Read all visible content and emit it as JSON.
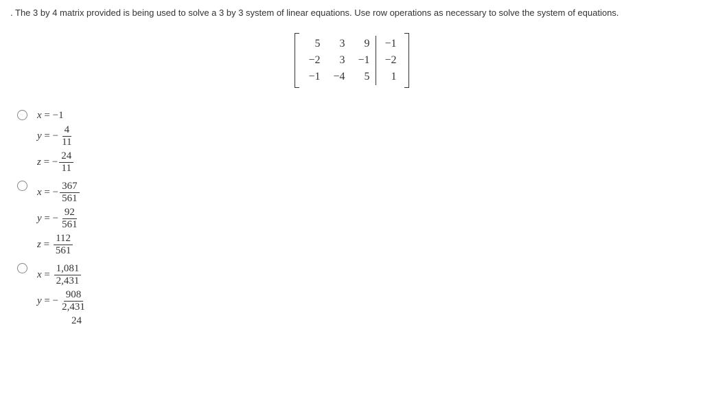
{
  "lead_char": ".",
  "prompt": "The 3 by 4 matrix provided is being used to solve a 3 by 3 system of linear equations. Use row operations as necessary to solve the system of equations.",
  "matrix": {
    "rows": [
      {
        "a": "5",
        "b": "3",
        "c": "9",
        "d": "−1"
      },
      {
        "a": "−2",
        "b": "3",
        "c": "−1",
        "d": "−2"
      },
      {
        "a": "−1",
        "b": "−4",
        "c": "5",
        "d": "1"
      }
    ]
  },
  "options": [
    {
      "eqs": [
        {
          "var": "x",
          "expr_plain": "−1"
        },
        {
          "var": "y",
          "neg": "−",
          "num": "4",
          "den": "11"
        },
        {
          "var": "z",
          "neg": "−",
          "num": "24",
          "den": "11"
        }
      ]
    },
    {
      "eqs": [
        {
          "var": "x",
          "neg": "−",
          "num": "367",
          "den": "561"
        },
        {
          "var": "y",
          "neg": "−",
          "num": "92",
          "den": "561"
        },
        {
          "var": "z",
          "neg": "",
          "num": "112",
          "den": "561"
        }
      ]
    },
    {
      "eqs": [
        {
          "var": "x",
          "neg": "",
          "num": "1,081",
          "den": "2,431"
        },
        {
          "var": "y",
          "neg": "−",
          "num": "908",
          "den": "2,431"
        },
        {
          "var": "z",
          "partial_num": "24"
        }
      ]
    }
  ]
}
